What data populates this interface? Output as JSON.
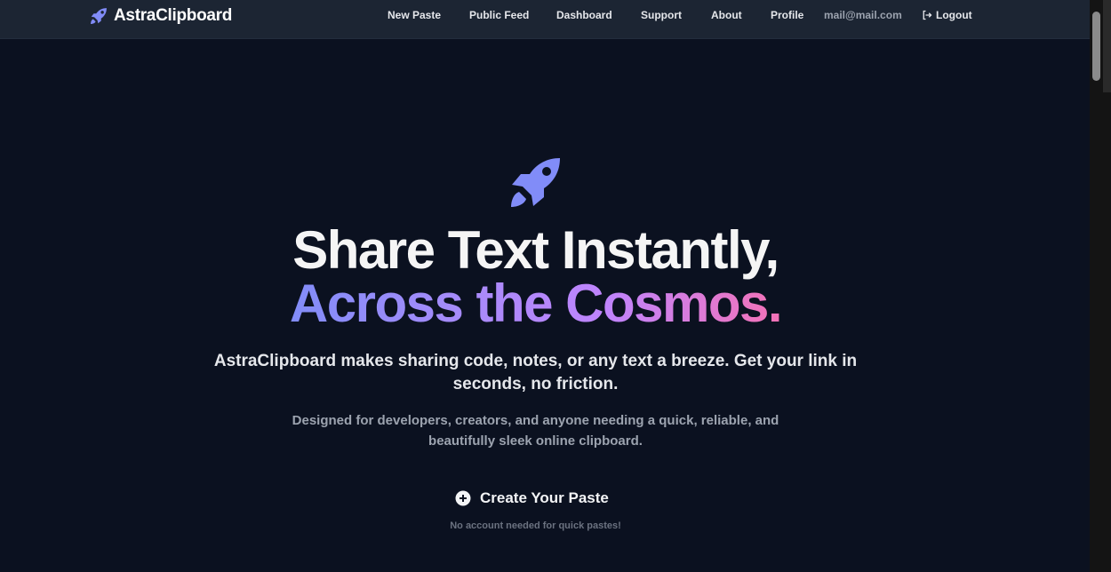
{
  "brand": {
    "name": "AstraClipboard",
    "icon": "rocket-icon",
    "accent_color": "#818cf8"
  },
  "nav": {
    "items": [
      {
        "label": "New Paste"
      },
      {
        "label": "Public Feed"
      },
      {
        "label": "Dashboard"
      },
      {
        "label": "Support"
      },
      {
        "label": "About"
      },
      {
        "label": "Profile"
      }
    ],
    "email": "mail@mail.com",
    "logout_label": "Logout"
  },
  "hero": {
    "icon": "rocket-icon",
    "title_line1": "Share Text Instantly,",
    "title_line2": "Across the Cosmos.",
    "gradient_colors": [
      "#818cf8",
      "#a78bfa",
      "#c084fc",
      "#f472b6"
    ],
    "subtitle": "AstraClipboard makes sharing code, notes, or any text a breeze. Get your link in seconds, no friction.",
    "description": "Designed for developers, creators, and anyone needing a quick, reliable, and beautifully sleek online clipboard.",
    "cta_label": "Create Your Paste",
    "cta_icon": "plus-circle-icon",
    "cta_note": "No account needed for quick pastes!"
  },
  "colors": {
    "background": "#0b1120",
    "navbar": "#1c2533"
  }
}
